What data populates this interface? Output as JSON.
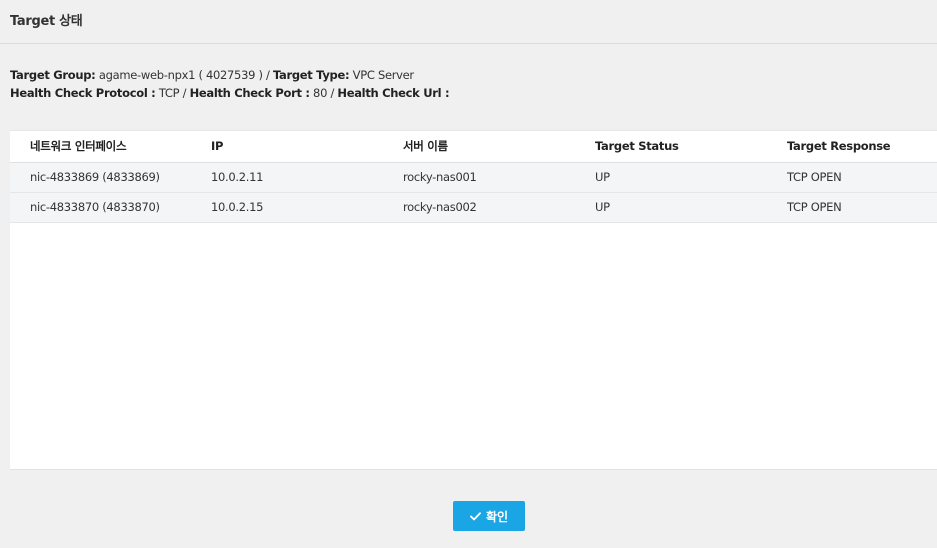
{
  "dialog": {
    "title": "Target 상태"
  },
  "info": {
    "target_group_label": "Target Group:",
    "target_group_value": "agame-web-npx1 ( 4027539 )",
    "separator": "/",
    "target_type_label": "Target Type:",
    "target_type_value": "VPC Server",
    "health_check_protocol_label": "Health Check Protocol :",
    "health_check_protocol_value": "TCP",
    "health_check_port_label": "Health Check Port :",
    "health_check_port_value": "80",
    "health_check_url_label": "Health Check Url :"
  },
  "table": {
    "headers": [
      "네트워크 인터페이스",
      "IP",
      "서버 이름",
      "Target Status",
      "Target Response"
    ],
    "rows": [
      [
        "nic-4833869 (4833869)",
        "10.0.2.11",
        "rocky-nas001",
        "UP",
        "TCP OPEN"
      ],
      [
        "nic-4833870 (4833870)",
        "10.0.2.15",
        "rocky-nas002",
        "UP",
        "TCP OPEN"
      ]
    ]
  },
  "footer": {
    "confirm_label": "확인",
    "confirm_icon": "check-icon"
  }
}
